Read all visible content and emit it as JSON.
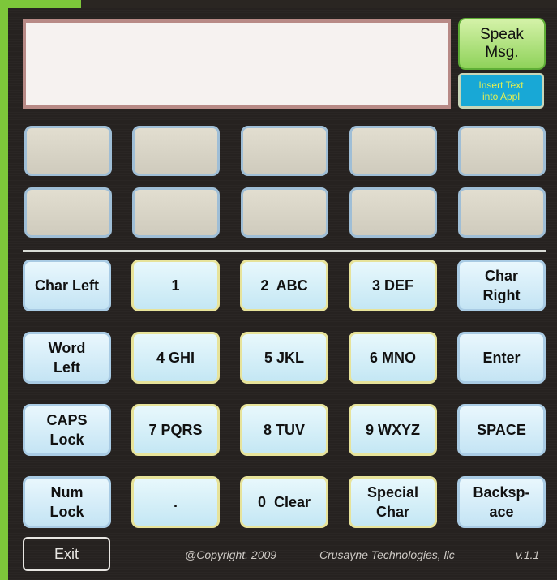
{
  "display": {
    "text": ""
  },
  "speak_button": {
    "label_line1": "Speak",
    "label_line2": "Msg."
  },
  "insert_button": {
    "label_line1": "Insert Text",
    "label_line2": "into Appl"
  },
  "prediction_slots": [
    "",
    "",
    "",
    "",
    "",
    "",
    "",
    "",
    "",
    ""
  ],
  "keys": {
    "char_left": "Char Left",
    "key_1": "1",
    "key_2": "2  ABC",
    "key_3": "3 DEF",
    "char_right_1": "Char",
    "char_right_2": "Right",
    "word_left_1": "Word",
    "word_left_2": "Left",
    "key_4": "4 GHI",
    "key_5": "5 JKL",
    "key_6": "6 MNO",
    "enter": "Enter",
    "caps_1": "CAPS",
    "caps_2": "Lock",
    "key_7": "7 PQRS",
    "key_8": "8 TUV",
    "key_9": "9 WXYZ",
    "space": "SPACE",
    "num_1": "Num",
    "num_2": "Lock",
    "period": ".",
    "key_0": "0  Clear",
    "special_1": "Special",
    "special_2": "Char",
    "backspace_1": "Backsp-",
    "backspace_2": "ace"
  },
  "exit_label": "Exit",
  "footer": {
    "copyright": "@Copyright. 2009",
    "company": "Crusayne Technologies, llc",
    "version": "v.1.1"
  },
  "colors": {
    "panel_bg": "#262220",
    "accent_green": "#7dc73a",
    "insert_bg": "#18a8d6",
    "insert_text": "#e6f050",
    "key_light_blue": "#c4e4f4"
  }
}
